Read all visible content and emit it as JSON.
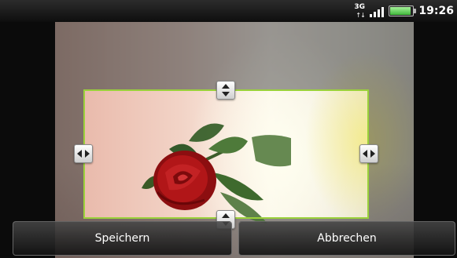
{
  "status_bar": {
    "network_label": "3G",
    "clock": "19:26",
    "icons": [
      "network-3g-icon",
      "signal-icon",
      "battery-icon"
    ]
  },
  "editor": {
    "image_subject": "red rose",
    "frame_color": "#9ad13a"
  },
  "actions": {
    "save_label": "Speichern",
    "cancel_label": "Abbrechen"
  }
}
